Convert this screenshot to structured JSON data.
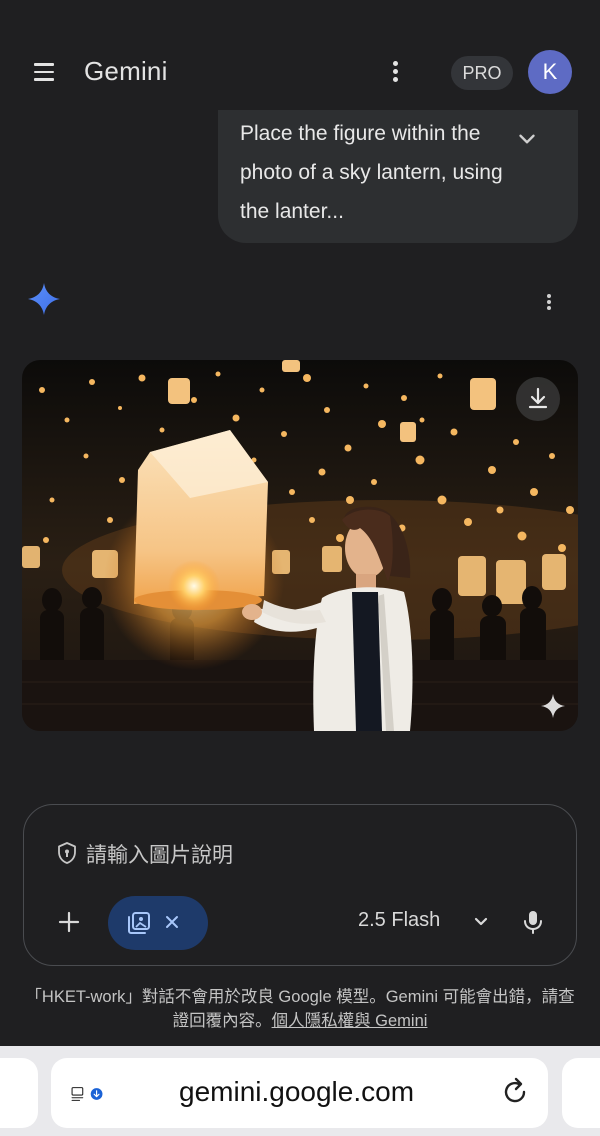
{
  "header": {
    "app_title": "Gemini",
    "plan_badge": "PRO",
    "avatar_initial": "K"
  },
  "conversation": {
    "user_message": "Place the figure within the photo of a sky lantern, using the lanter...",
    "image_description": "Woman in a white cardigan releasing a large glowing paper sky lantern at night with many floating lanterns above a crowd"
  },
  "composer": {
    "placeholder": "請輸入圖片說明",
    "model": "2.5 Flash"
  },
  "disclaimer": {
    "text": "「HKET-work」對話不會用於改良 Google 模型。Gemini 可能會出錯，請查證回覆內容。",
    "link": "個人隱私權與 Gemini"
  },
  "browser": {
    "url": "gemini.google.com"
  },
  "colors": {
    "background": "#1f1f21",
    "bubble": "#2d2f31",
    "chip": "#1e3a6a",
    "avatar": "#5e6bc4",
    "gemini_star": "#4d86f7"
  }
}
